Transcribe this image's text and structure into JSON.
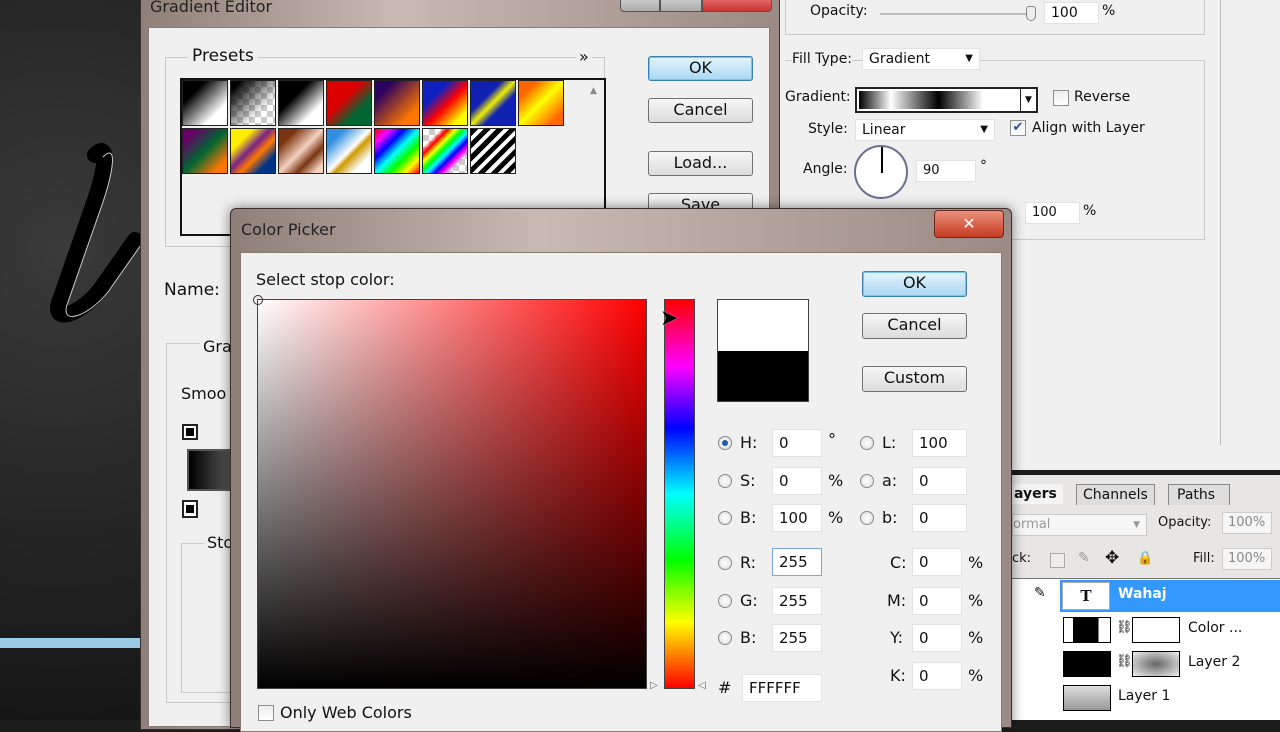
{
  "gradient_editor": {
    "title": "Gradient Editor",
    "presets_label": "Presets",
    "presets_menu": "»",
    "ok": "OK",
    "cancel": "Cancel",
    "load": "Load...",
    "save": "Save",
    "name_label": "Name:",
    "gradient_type_label": "Gra",
    "smoothness_label": "Smoo",
    "stops_label": "Sto"
  },
  "layer_style": {
    "opacity_label": "Opacity:",
    "opacity_value": "100",
    "opacity_unit": "%",
    "fill_type_label": "Fill Type:",
    "fill_type_value": "Gradient",
    "gradient_label": "Gradient:",
    "reverse_label": "Reverse",
    "reverse_checked": false,
    "style_label": "Style:",
    "style_value": "Linear",
    "align_label": "Align with Layer",
    "align_checked": true,
    "angle_label": "Angle:",
    "angle_value": "90",
    "angle_unit": "°",
    "scale_value": "100",
    "scale_unit": "%"
  },
  "layers_panel": {
    "tabs": [
      "ayers",
      "Channels",
      "Paths"
    ],
    "blend_mode": "ormal",
    "opacity_label": "Opacity:",
    "opacity_value": "100%",
    "lock_label": "ck:",
    "fill_label": "Fill:",
    "fill_value": "100%",
    "layers": [
      {
        "name": "Wahaj",
        "selected": true
      },
      {
        "name": "Color ..."
      },
      {
        "name": "Layer 2"
      },
      {
        "name": "Layer 1"
      }
    ]
  },
  "color_picker": {
    "title": "Color Picker",
    "prompt": "Select stop color:",
    "ok": "OK",
    "cancel": "Cancel",
    "custom": "Custom",
    "fields": {
      "H": {
        "label": "H:",
        "value": "0",
        "unit": "°"
      },
      "S": {
        "label": "S:",
        "value": "0",
        "unit": "%"
      },
      "Bv": {
        "label": "B:",
        "value": "100",
        "unit": "%"
      },
      "R": {
        "label": "R:",
        "value": "255"
      },
      "G": {
        "label": "G:",
        "value": "255"
      },
      "B": {
        "label": "B:",
        "value": "255"
      },
      "L": {
        "label": "L:",
        "value": "100"
      },
      "a": {
        "label": "a:",
        "value": "0"
      },
      "b": {
        "label": "b:",
        "value": "0"
      },
      "C": {
        "label": "C:",
        "value": "0",
        "unit": "%"
      },
      "M": {
        "label": "M:",
        "value": "0",
        "unit": "%"
      },
      "Y": {
        "label": "Y:",
        "value": "0",
        "unit": "%"
      },
      "K": {
        "label": "K:",
        "value": "0",
        "unit": "%"
      }
    },
    "hex_label": "#",
    "hex_value": "FFFFFF",
    "web_colors_label": "Only Web Colors",
    "new_color": "#ffffff",
    "current_color": "#000000"
  }
}
